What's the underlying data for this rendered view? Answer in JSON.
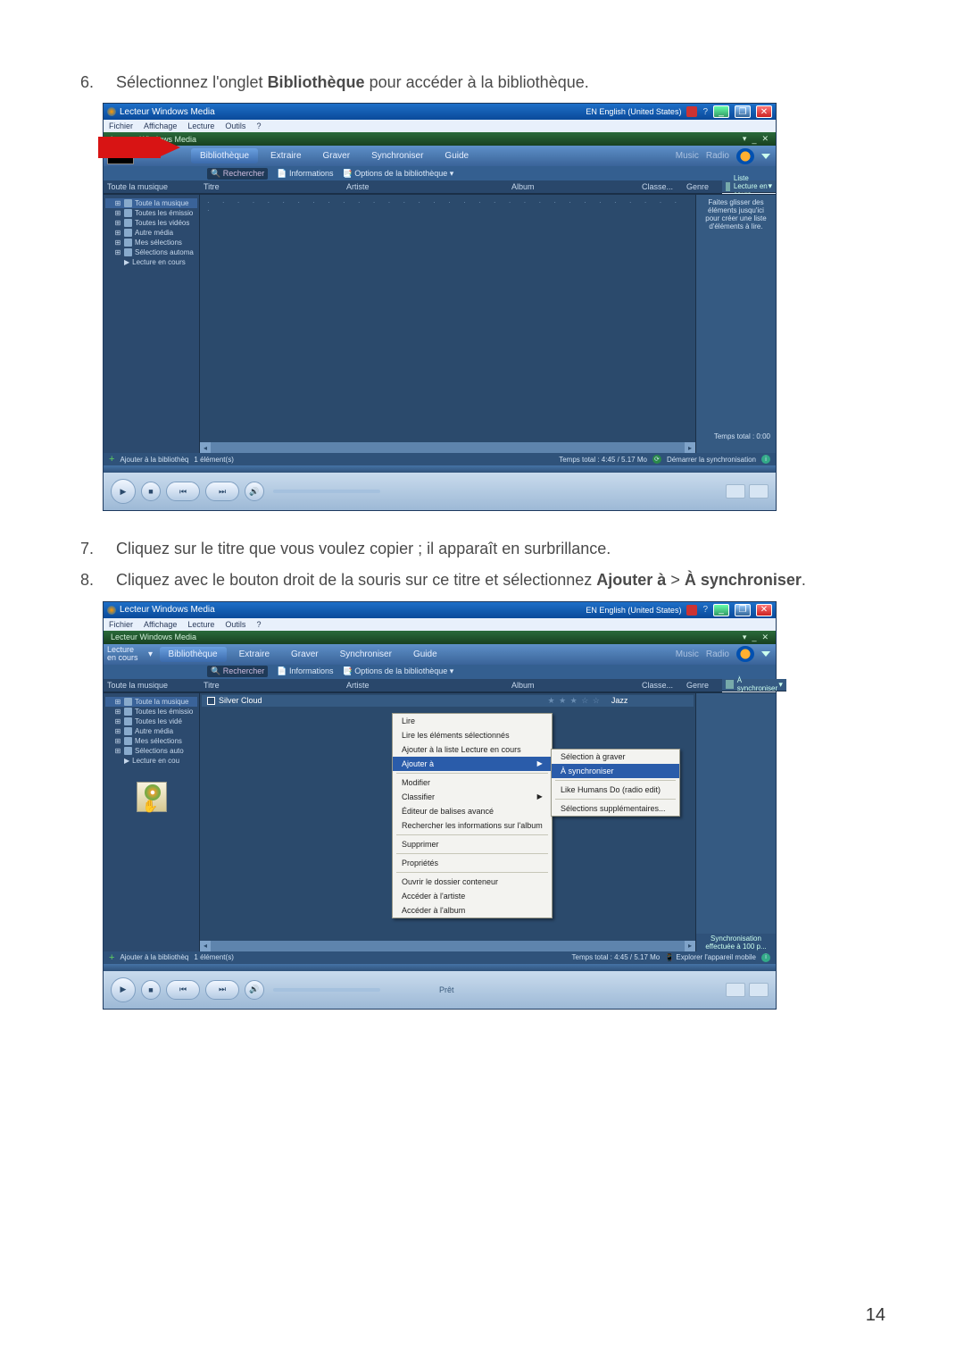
{
  "page_number": "14",
  "steps": {
    "s6": {
      "num": "6.",
      "pre": "Sélectionnez l'onglet ",
      "b": "Bibliothèque",
      "post": " pour accéder à la bibliothèque."
    },
    "s7": {
      "num": "7.",
      "text": "Cliquez sur le titre que vous voulez copier ; il apparaît en surbrillance."
    },
    "s8": {
      "num": "8.",
      "pre": "Cliquez avec le bouton droit de la souris sur ce titre et sélectionnez ",
      "b1": "Ajouter à",
      "mid": " > ",
      "b2": "À synchroniser",
      "post": "."
    }
  },
  "wmp": {
    "title": "Lecteur Windows Media",
    "lang": "EN English (United States)",
    "menus": [
      "Fichier",
      "Affichage",
      "Lecture",
      "Outils",
      "?"
    ],
    "appbar_title": "Lecteur Windows Media",
    "tabs": {
      "nowplaying": "Lecture\nen cours",
      "library": "Bibliothèque",
      "rip": "Extraire",
      "burn": "Graver",
      "sync": "Synchroniser",
      "guide": "Guide",
      "right_links": [
        "Music",
        "Radio"
      ]
    },
    "toolbar2": {
      "search": "Rechercher",
      "info": "Informations",
      "options": "Options de la bibliothèque"
    },
    "columns": {
      "tree": "Toute la musique",
      "titre": "Titre",
      "artiste": "Artiste",
      "album": "Album",
      "classe": "Classe...",
      "genre": "Genre"
    },
    "tree": [
      "Toute la musique",
      "Toutes les émissio",
      "Toutes les vidéos",
      "Autre média",
      "Mes sélections",
      "Sélections automa",
      "Lecture en cours"
    ],
    "tree2": [
      "Toute la musique",
      "Toutes les émissio",
      "Toutes les vidé",
      "Autre média",
      "Mes sélections",
      "Sélections auto",
      "Lecture en cou"
    ],
    "rp1_title": "Liste Lecture en cours",
    "rp1_hint": "Faites glisser des éléments jusqu'ici pour créer une liste d'éléments à lire.",
    "rp1_total": "Temps total : 0:00",
    "rp2_title": "À synchroniser",
    "rp2_sync": "Synchronisation effectuée à 100 p...",
    "status": {
      "add": "Ajouter à la bibliothèq",
      "count": "1 élément(s)",
      "total": "Temps total : 4:45 / 5.17 Mo",
      "start_sync": "Démarrer la synchronisation",
      "explore": "Explorer l'appareil mobile"
    },
    "track": {
      "title": "Silver Cloud",
      "genre": "Jazz"
    },
    "ctx": {
      "lire": "Lire",
      "lire_sel": "Lire les éléments sélectionnés",
      "ajouter_liste": "Ajouter à la liste Lecture en cours",
      "ajouter_a": "Ajouter à",
      "modifier": "Modifier",
      "classifier": "Classifier",
      "balises": "Éditeur de balises avancé",
      "rechercher": "Rechercher les informations sur l'album",
      "supprimer": "Supprimer",
      "proprietes": "Propriétés",
      "ouvrir": "Ouvrir le dossier conteneur",
      "artiste": "Accéder à l'artiste",
      "album": "Accéder à l'album"
    },
    "submenu": {
      "graver": "Sélection à graver",
      "sync": "À synchroniser",
      "like": "Like Humans Do (radio edit)",
      "suppl": "Sélections supplémentaires..."
    },
    "player_label": "Prêt"
  }
}
